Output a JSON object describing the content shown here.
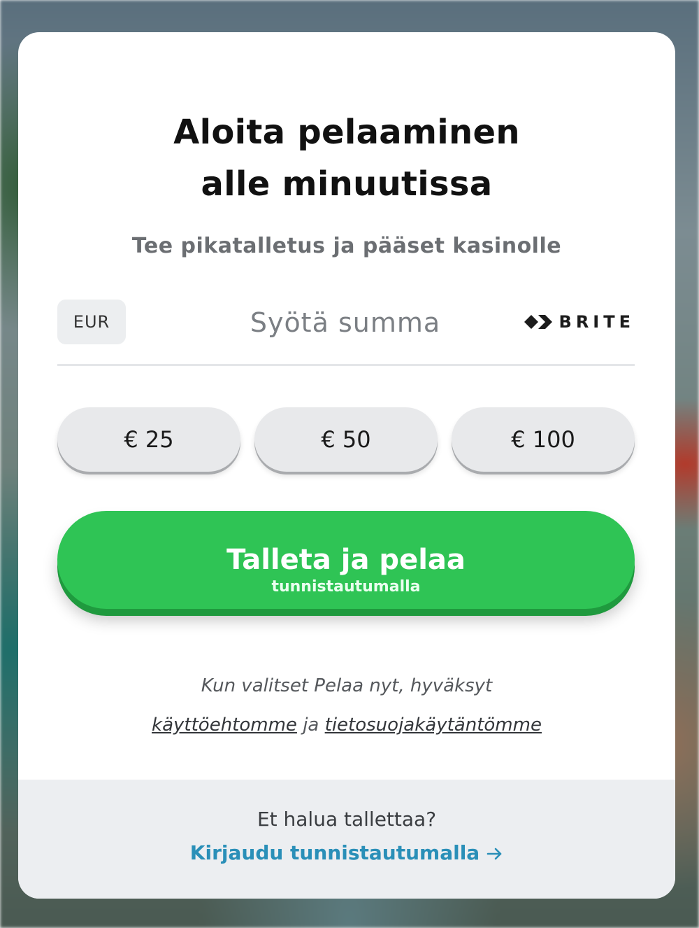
{
  "card": {
    "title_line1": "Aloita pelaaminen",
    "title_line2": "alle minuutissa",
    "subtitle": "Tee pikatalletus ja pääset kasinolle"
  },
  "amount": {
    "currency": "EUR",
    "placeholder": "Syötä summa",
    "value": "",
    "provider": "BRITE",
    "provider_icon": "brite-logo-icon"
  },
  "presets": [
    {
      "label": "€ 25"
    },
    {
      "label": "€ 50"
    },
    {
      "label": "€ 100"
    }
  ],
  "cta": {
    "main": "Talleta ja pelaa",
    "sub": "tunnistautumalla",
    "color": "#2fc455"
  },
  "terms": {
    "line1": "Kun valitset Pelaa nyt, hyväksyt",
    "terms_link": "käyttöehtomme",
    "conjunction": "ja",
    "privacy_link": "tietosuojakäytäntömme"
  },
  "footer": {
    "question": "Et halua tallettaa?",
    "login_link": "Kirjaudu tunnistautumalla",
    "link_icon": "arrow-right-icon",
    "link_color": "#2a8fb8"
  }
}
